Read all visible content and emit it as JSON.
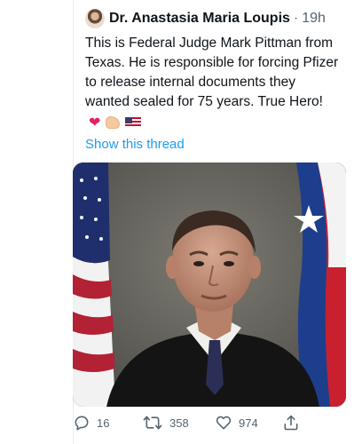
{
  "tweet": {
    "author_name": "Dr. Anastasia Maria Loupis",
    "separator": "·",
    "timestamp": "19h",
    "body": "This is Federal Judge Mark Pittman from Texas. He is responsible for forcing Pfizer to release internal documents they wanted sealed for 75 years. True Hero!",
    "emoji_names": [
      "red-heart",
      "flexed-biceps",
      "us-flag"
    ],
    "show_thread_label": "Show this thread"
  },
  "actions": {
    "replies": "16",
    "retweets": "358",
    "likes": "974"
  },
  "colors": {
    "text": "#0f1419",
    "secondary": "#536471",
    "link": "#1d9bf0",
    "heart": "#e0245e"
  }
}
